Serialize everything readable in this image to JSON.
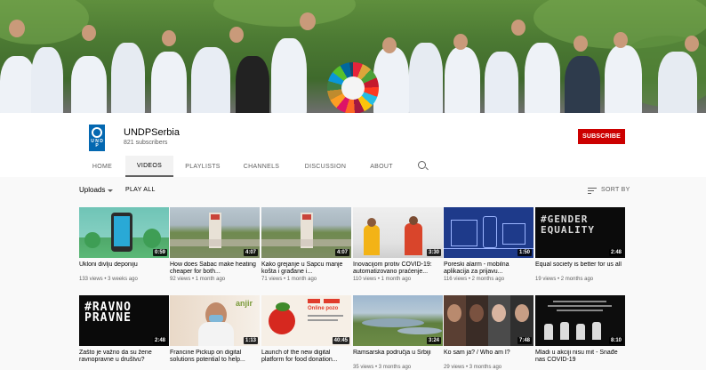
{
  "channel": {
    "name": "UNDPSerbia",
    "subscribers": "821 subscribers",
    "subscribe_label": "SUBSCRIBE",
    "logo_text": "U N D P"
  },
  "tabs": [
    {
      "label": "HOME"
    },
    {
      "label": "VIDEOS",
      "active": true
    },
    {
      "label": "PLAYLISTS"
    },
    {
      "label": "CHANNELS"
    },
    {
      "label": "DISCUSSION"
    },
    {
      "label": "ABOUT"
    }
  ],
  "toolbar": {
    "uploads_label": "Uploads",
    "play_all_label": "PLAY ALL",
    "sort_label": "SORT BY"
  },
  "videos": [
    {
      "title": "Ukloni divlju deponiju",
      "meta": "133 views • 3 weeks ago",
      "duration": "0:59"
    },
    {
      "title": "How does Sabac make heating cheaper for both...",
      "meta": "92 views • 1 month ago",
      "duration": "4:07"
    },
    {
      "title": "Kako grejanje u Sapcu manje košta i građane i...",
      "meta": "71 views • 1 month ago",
      "duration": "4:07"
    },
    {
      "title": "Inovacijom protiv COVID-19: automatizovano praćenje...",
      "meta": "110 views • 1 month ago",
      "duration": "3:30"
    },
    {
      "title": "Poreski alarm - mobilna aplikacija za prijavu...",
      "meta": "116 views • 2 months ago",
      "duration": "1:50"
    },
    {
      "title": "Equal society is better for us all",
      "meta": "19 views • 2 months ago",
      "duration": "2:48",
      "overlay": "#GENDER EQUALITY"
    },
    {
      "title": "Zašto je važno da su žene ravnopravne u društvu?",
      "meta": "",
      "duration": "2:48",
      "overlay": "#RAVNO PRAVNE"
    },
    {
      "title": "Francine Pickup on digital solutions potential to help...",
      "meta": "",
      "duration": "1:13",
      "overlay": "anjir"
    },
    {
      "title": "Launch of the new digital platform for food donation...",
      "meta": "",
      "duration": "40:45",
      "overlay": "Online pozo"
    },
    {
      "title": "Ramsarska područja u Srbiji",
      "meta": "35 views • 3 months ago",
      "duration": "3:24"
    },
    {
      "title": "Ko sam ja? / Who am I?",
      "meta": "29 views • 3 months ago",
      "duration": "7:48"
    },
    {
      "title": "Mladi u akciji nisu mit - Snađe nas COVID-19",
      "meta": "",
      "duration": "8:10"
    }
  ]
}
